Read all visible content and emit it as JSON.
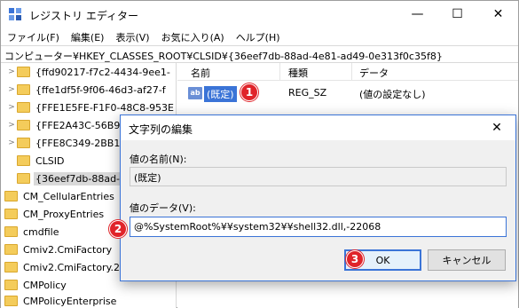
{
  "window": {
    "title": "レジストリ エディター",
    "minimize": "—",
    "maximize": "☐",
    "close": "✕"
  },
  "menu": [
    "ファイル(F)",
    "編集(E)",
    "表示(V)",
    "お気に入り(A)",
    "ヘルプ(H)"
  ],
  "address": "コンピューター¥HKEY_CLASSES_ROOT¥CLSID¥{36eef7db-88ad-4e81-ad49-0e313f0c35f8}",
  "tree": [
    {
      "label": "{ffd90217-f7c2-4434-9ee1-",
      "arrow": ">"
    },
    {
      "label": "{ffe1df5f-9f06-46d3-af27-f",
      "arrow": ">"
    },
    {
      "label": "{FFE1E5FE-F1F0-48C8-953E",
      "arrow": ">"
    },
    {
      "label": "{FFE2A43C-56B9-4BF5-9A79",
      "arrow": ">"
    },
    {
      "label": "{FFE8C349-2BB1-4",
      "arrow": ">"
    },
    {
      "label": "CLSID",
      "arrow": ""
    },
    {
      "label": "{36eef7db-88ad-4",
      "arrow": ""
    },
    {
      "label": "CM_CellularEntries",
      "arrow": ""
    },
    {
      "label": "CM_ProxyEntries",
      "arrow": ""
    },
    {
      "label": "cmdfile",
      "arrow": ""
    },
    {
      "label": "Cmiv2.CmiFactory",
      "arrow": ""
    },
    {
      "label": "Cmiv2.CmiFactory.2",
      "arrow": ""
    },
    {
      "label": "CMPolicy",
      "arrow": ""
    },
    {
      "label": "CMPolicyEnterprise",
      "arrow": ""
    }
  ],
  "columns": {
    "name": "名前",
    "type": "種類",
    "data": "データ"
  },
  "value_row": {
    "icon": "ab",
    "name": "(既定)",
    "type": "REG_SZ",
    "data": "(値の設定なし)"
  },
  "dialog": {
    "title": "文字列の編集",
    "close": "✕",
    "name_label": "値の名前(N):",
    "name_value": "(既定)",
    "data_label": "値のデータ(V):",
    "data_value": "@%SystemRoot%¥¥system32¥¥shell32.dll,-22068",
    "ok": "OK",
    "cancel": "キャンセル"
  },
  "badges": {
    "one": "1",
    "two": "2",
    "three": "3"
  },
  "colors": {
    "accent": "#3b74d7",
    "badge": "#e0242a",
    "folder": "#f4cc5b"
  }
}
